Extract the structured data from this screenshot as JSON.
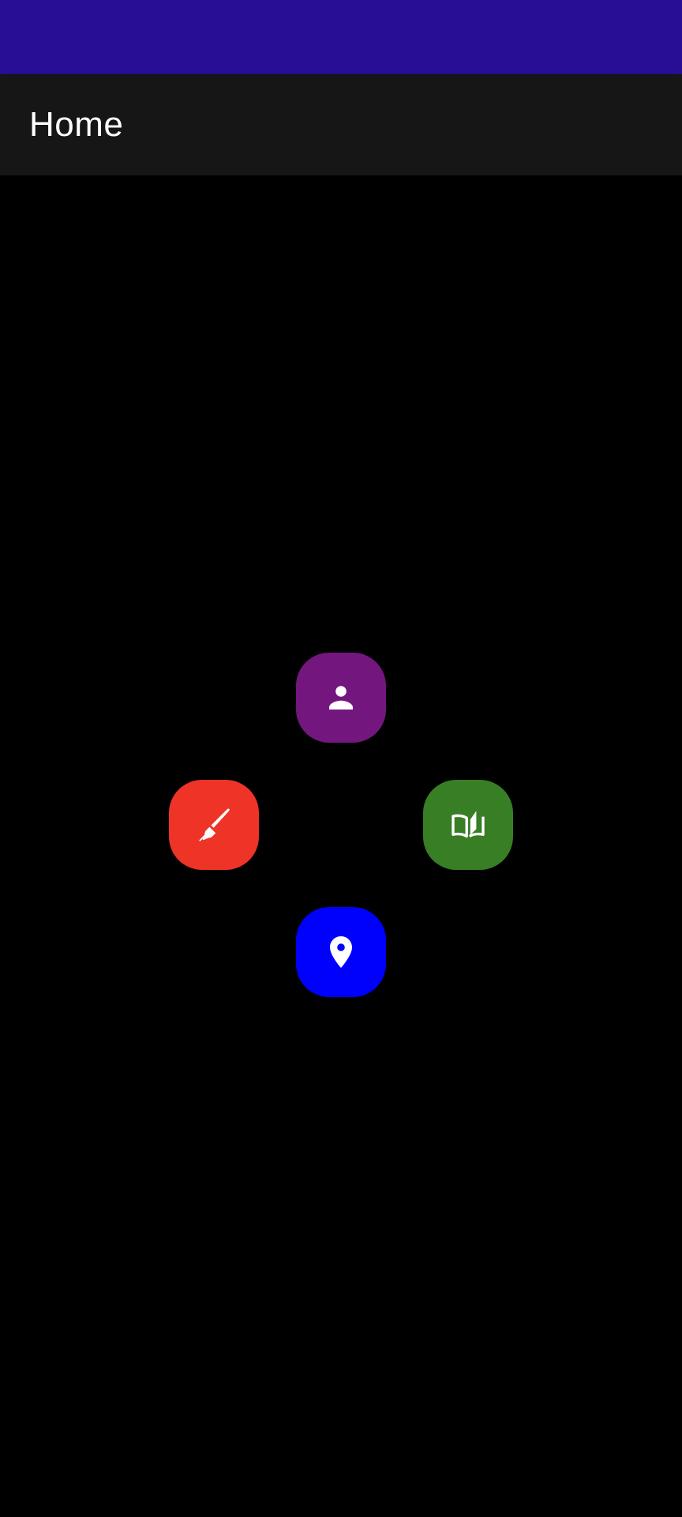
{
  "colors": {
    "status_bar": "#270e94",
    "app_bar": "#161616",
    "background": "#000000",
    "profile_button": "#73177f",
    "draw_button": "#ee3327",
    "read_button": "#387e24",
    "location_button": "#0000fd",
    "icon": "#ffffff"
  },
  "app_bar": {
    "title": "Home"
  },
  "buttons": [
    {
      "id": "profile",
      "icon": "person-icon"
    },
    {
      "id": "draw",
      "icon": "brush-icon"
    },
    {
      "id": "read",
      "icon": "book-icon"
    },
    {
      "id": "location",
      "icon": "location-pin-icon"
    }
  ]
}
